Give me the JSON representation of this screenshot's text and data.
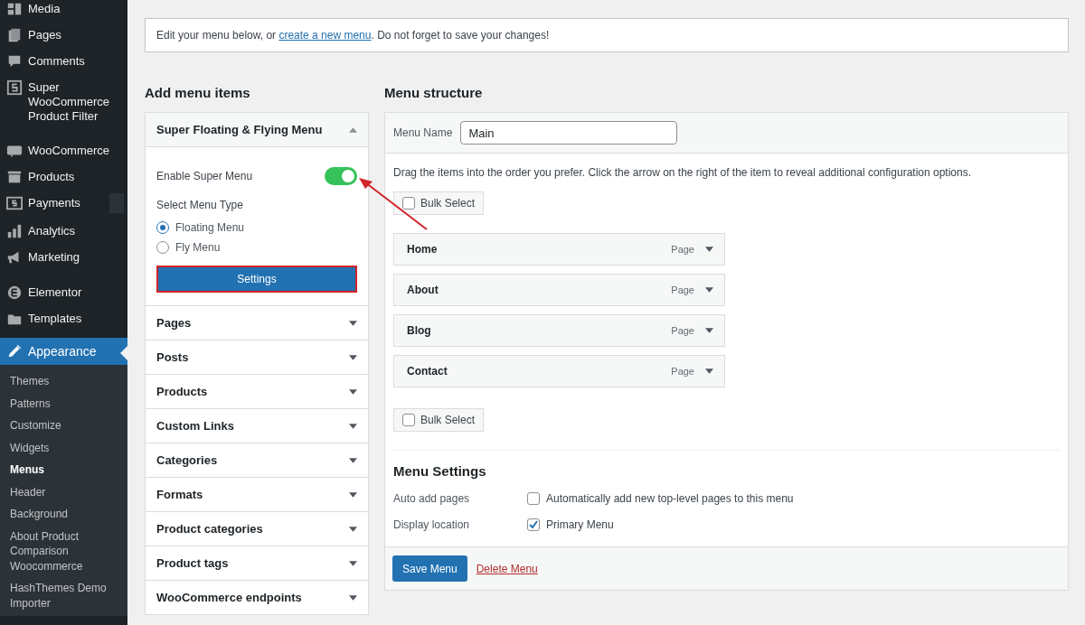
{
  "sidebar": {
    "items": [
      {
        "label": "Media",
        "selected": false
      },
      {
        "label": "Pages",
        "selected": false
      },
      {
        "label": "Comments",
        "selected": false
      },
      {
        "label": "Super WooCommerce Product Filter",
        "selected": false
      },
      {
        "label": "WooCommerce",
        "selected": false,
        "gap": true
      },
      {
        "label": "Products",
        "selected": false
      },
      {
        "label": "Payments",
        "selected": false,
        "badge": true
      },
      {
        "label": "Analytics",
        "selected": false
      },
      {
        "label": "Marketing",
        "selected": false
      },
      {
        "label": "Elementor",
        "selected": false,
        "gap": true
      },
      {
        "label": "Templates",
        "selected": false
      },
      {
        "label": "Appearance",
        "selected": true,
        "children": [
          {
            "label": "Themes",
            "selected": false
          },
          {
            "label": "Patterns",
            "selected": false
          },
          {
            "label": "Customize",
            "selected": false
          },
          {
            "label": "Widgets",
            "selected": false
          },
          {
            "label": "Menus",
            "selected": true
          },
          {
            "label": "Header",
            "selected": false
          },
          {
            "label": "Background",
            "selected": false
          },
          {
            "label": "About Product Comparison Woocommerce",
            "selected": false
          },
          {
            "label": "HashThemes Demo Importer",
            "selected": false
          }
        ]
      }
    ]
  },
  "notice": {
    "before": "Edit your menu below, or ",
    "link": "create a new menu",
    "after": ". Do not forget to save your changes!"
  },
  "add_items": {
    "title": "Add menu items",
    "sections": [
      {
        "title": "Super Floating & Flying Menu",
        "expanded": true
      },
      {
        "title": "Pages",
        "expanded": false
      },
      {
        "title": "Posts",
        "expanded": false
      },
      {
        "title": "Products",
        "expanded": false
      },
      {
        "title": "Custom Links",
        "expanded": false
      },
      {
        "title": "Categories",
        "expanded": false
      },
      {
        "title": "Formats",
        "expanded": false
      },
      {
        "title": "Product categories",
        "expanded": false
      },
      {
        "title": "Product tags",
        "expanded": false
      },
      {
        "title": "WooCommerce endpoints",
        "expanded": false
      }
    ],
    "toggle": {
      "label": "Enable Super Menu",
      "on": true
    },
    "menu_type": {
      "label": "Select Menu Type",
      "options": [
        {
          "label": "Floating Menu",
          "selected": true
        },
        {
          "label": "Fly Menu",
          "selected": false
        }
      ]
    },
    "settings_button": {
      "label": "Settings",
      "highlighted": true
    }
  },
  "structure": {
    "title": "Menu structure",
    "menu_name_label": "Menu Name",
    "menu_name_value": "Main",
    "hint": "Drag the items into the order you prefer. Click the arrow on the right of the item to reveal additional configuration options.",
    "bulk_select_top": {
      "label": "Bulk Select",
      "checked": false
    },
    "items": [
      {
        "title": "Home",
        "type": "Page"
      },
      {
        "title": "About",
        "type": "Page"
      },
      {
        "title": "Blog",
        "type": "Page"
      },
      {
        "title": "Contact",
        "type": "Page"
      }
    ],
    "bulk_select_bottom": {
      "label": "Bulk Select",
      "checked": false
    },
    "settings_title": "Menu Settings",
    "settings": [
      {
        "label": "Auto add pages",
        "option": "Automatically add new top-level pages to this menu",
        "checked": false
      },
      {
        "label": "Display location",
        "option": "Primary Menu",
        "checked": true
      }
    ],
    "save_button": "Save Menu",
    "delete_link": "Delete Menu"
  }
}
